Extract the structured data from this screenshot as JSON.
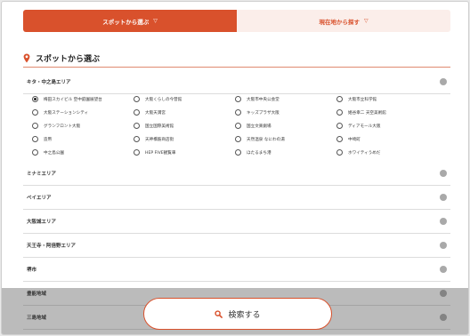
{
  "tabs": [
    {
      "label": "スポットから選ぶ",
      "chev": "▽"
    },
    {
      "label": "現在地から探す",
      "chev": "▽"
    }
  ],
  "section": {
    "title": "スポットから選ぶ"
  },
  "areas": {
    "kita": "キタ・中之島エリア",
    "minami": "ミナミエリア",
    "bay": "ベイエリア",
    "osakajo": "大阪城エリア",
    "tennoji": "天王寺・阿倍野エリア",
    "sakai": "堺市",
    "hokusetsu": "豊能地域",
    "mishima": "三島地域"
  },
  "spots": [
    "梅田スカイビル 空中庭園展望台",
    "大阪くらしの今昔館",
    "大阪市中央公会堂",
    "大阪市立科学館",
    "大阪ステーションシティ",
    "大阪天満宮",
    "キッズプラザ大阪",
    "姫谷幸二 天空美術館",
    "グランフロント大阪",
    "国立国際美術館",
    "国立文楽劇場",
    "ディアモール大阪",
    "造幣",
    "天神橋筋商店街",
    "天然温泉 なにわの湯",
    "中崎町",
    "中之島公園",
    "HEP FIVE観覧車",
    "ほたるまち港",
    "ホワイティうめだ"
  ],
  "selected_index": 0,
  "search": {
    "label": "検索する"
  }
}
